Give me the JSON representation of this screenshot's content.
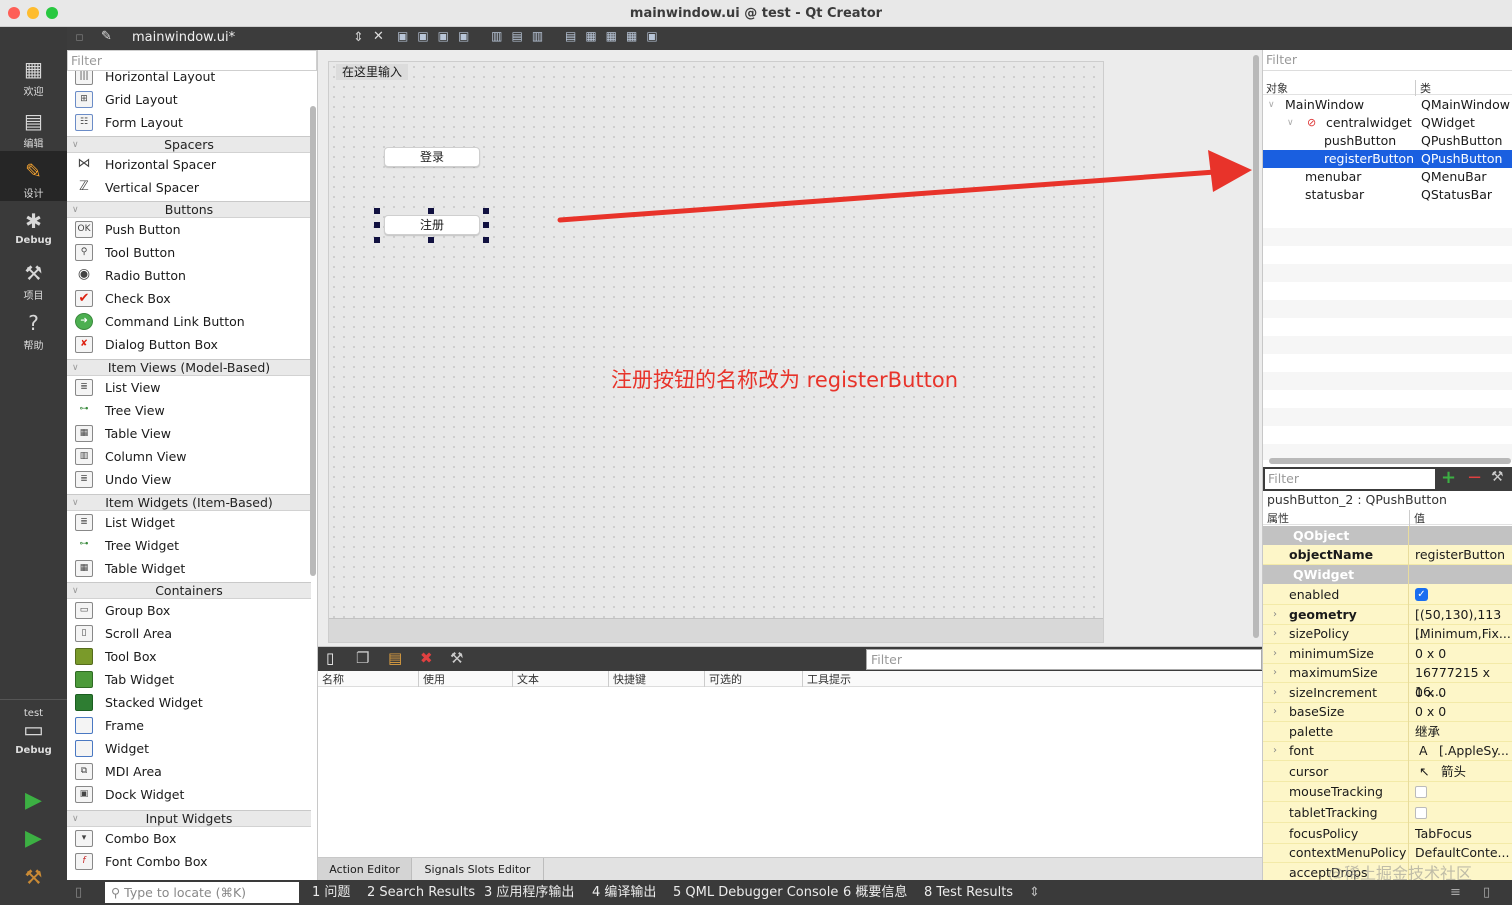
{
  "window": {
    "title": "mainwindow.ui @ test - Qt Creator"
  },
  "modes": [
    {
      "icon": "grid-icon",
      "label": "欢迎"
    },
    {
      "icon": "edit-doc-icon",
      "label": "编辑"
    },
    {
      "icon": "pencil-icon",
      "label": "设计"
    },
    {
      "icon": "bug-icon",
      "label": "Debug"
    },
    {
      "icon": "wrench-icon",
      "label": "项目"
    },
    {
      "icon": "help-icon",
      "label": "帮助"
    }
  ],
  "kit": {
    "project": "test",
    "config": "Debug"
  },
  "doc_tab": {
    "file": "mainwindow.ui*"
  },
  "widget_box": {
    "filter_placeholder": "Filter",
    "categories": {
      "spacers": "Spacers",
      "buttons": "Buttons",
      "item_views": "Item Views (Model-Based)",
      "item_widgets": "Item Widgets (Item-Based)",
      "containers": "Containers",
      "input_widgets": "Input Widgets"
    },
    "layouts": [
      "Horizontal Layout",
      "Grid Layout",
      "Form Layout"
    ],
    "spacers": [
      "Horizontal Spacer",
      "Vertical Spacer"
    ],
    "buttons": [
      "Push Button",
      "Tool Button",
      "Radio Button",
      "Check Box",
      "Command Link Button",
      "Dialog Button Box"
    ],
    "item_views": [
      "List View",
      "Tree View",
      "Table View",
      "Column View",
      "Undo View"
    ],
    "item_widgets": [
      "List Widget",
      "Tree Widget",
      "Table Widget"
    ],
    "containers": [
      "Group Box",
      "Scroll Area",
      "Tool Box",
      "Tab Widget",
      "Stacked Widget",
      "Frame",
      "Widget",
      "MDI Area",
      "Dock Widget"
    ],
    "input_widgets": [
      "Combo Box",
      "Font Combo Box"
    ]
  },
  "form": {
    "menu_placeholder": "在这里输入",
    "login_button": "登录",
    "register_button": "注册",
    "annotation": "注册按钮的名称改为 registerButton"
  },
  "action_editor": {
    "filter_placeholder": "Filter",
    "columns": [
      "名称",
      "使用",
      "文本",
      "快捷键",
      "可选的",
      "工具提示"
    ],
    "tabs": [
      "Action Editor",
      "Signals  Slots Editor"
    ]
  },
  "object_inspector": {
    "filter_placeholder": "Filter",
    "col_object": "对象",
    "col_class": "类",
    "rows": [
      {
        "name": "MainWindow",
        "cls": "QMainWindow"
      },
      {
        "name": "centralwidget",
        "cls": "QWidget"
      },
      {
        "name": "pushButton",
        "cls": "QPushButton"
      },
      {
        "name": "registerButton",
        "cls": "QPushButton"
      },
      {
        "name": "menubar",
        "cls": "QMenuBar"
      },
      {
        "name": "statusbar",
        "cls": "QStatusBar"
      }
    ]
  },
  "property_editor": {
    "filter_placeholder": "Filter",
    "current": "pushButton_2 : QPushButton",
    "col_prop": "属性",
    "col_value": "值",
    "group_qobject": "QObject",
    "group_qwidget": "QWidget",
    "objectName": {
      "name": "objectName",
      "value": "registerButton"
    },
    "rows": [
      {
        "name": "enabled",
        "value": ""
      },
      {
        "name": "geometry",
        "value": "[(50,130),113 ..."
      },
      {
        "name": "sizePolicy",
        "value": "[Minimum,Fix..."
      },
      {
        "name": "minimumSize",
        "value": "0 x 0"
      },
      {
        "name": "maximumSize",
        "value": "16777215 x 16..."
      },
      {
        "name": "sizeIncrement",
        "value": "0 x 0"
      },
      {
        "name": "baseSize",
        "value": "0 x 0"
      },
      {
        "name": "palette",
        "value": "继承"
      },
      {
        "name": "font",
        "value": "[.AppleSy..."
      },
      {
        "name": "cursor",
        "value": "箭头"
      },
      {
        "name": "mouseTracking",
        "value": ""
      },
      {
        "name": "tabletTracking",
        "value": ""
      },
      {
        "name": "focusPolicy",
        "value": "TabFocus"
      },
      {
        "name": "contextMenuPolicy",
        "value": "DefaultConte..."
      },
      {
        "name": "acceptDrops",
        "value": ""
      }
    ]
  },
  "status": {
    "locate_placeholder": "Type to locate (⌘K)",
    "panes": [
      "1  问题",
      "2  Search Results",
      "3  应用程序输出",
      "4  编译输出",
      "5  QML Debugger Console",
      "6  概要信息",
      "8  Test Results"
    ]
  },
  "watermark": "@稀土掘金技术社区",
  "colors": {
    "accent": "#1a5fe0",
    "annotation": "#e8332a",
    "modebar": "#3a3a3a",
    "property_bg": "#fdf6c8"
  }
}
